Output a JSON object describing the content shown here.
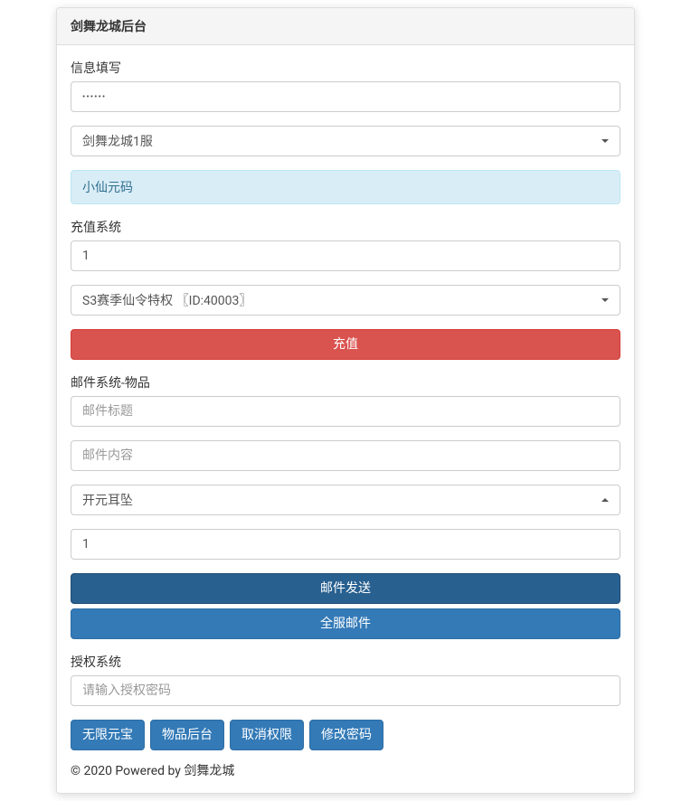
{
  "header": {
    "title": "剑舞龙城后台"
  },
  "info": {
    "section_label": "信息填写",
    "password_value": "••••••",
    "server_selected": "剑舞龙城1服",
    "player_name": "小仙元码"
  },
  "recharge": {
    "section_label": "充值系统",
    "amount_value": "1",
    "item_selected": "S3赛季仙令特权 〖ID:40003〗",
    "submit_label": "充值"
  },
  "mail": {
    "section_label": "邮件系统-物品",
    "title_placeholder": "邮件标题",
    "content_placeholder": "邮件内容",
    "item_selected": "开元耳坠",
    "quantity_value": "1",
    "send_label": "邮件发送",
    "broadcast_label": "全服邮件"
  },
  "auth": {
    "section_label": "授权系统",
    "password_placeholder": "请输入授权密码"
  },
  "actions": {
    "unlimited_gold": "无限元宝",
    "item_backend": "物品后台",
    "cancel_auth": "取消权限",
    "change_password": "修改密码"
  },
  "footer": {
    "text": "© 2020 Powered by 剑舞龙城"
  }
}
